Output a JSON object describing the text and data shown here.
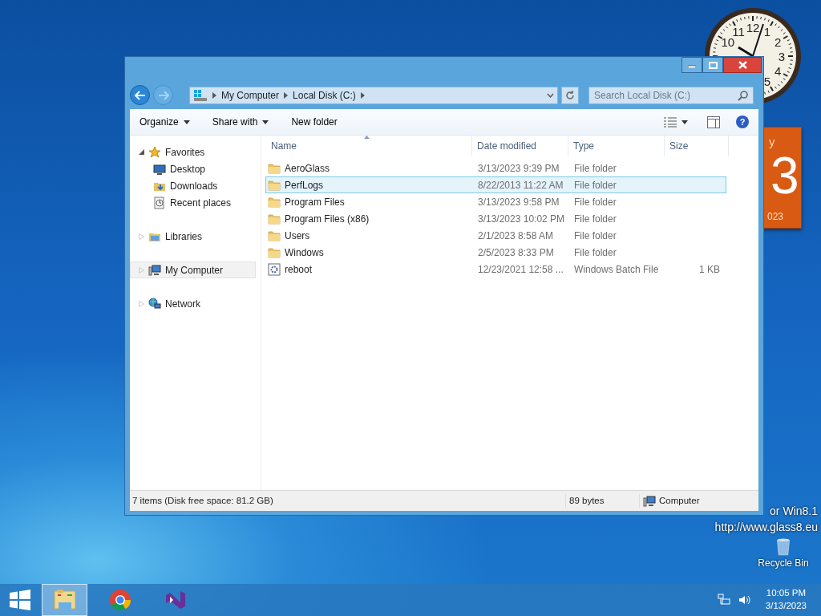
{
  "clock": {
    "numerals": [
      "10",
      "11",
      "12",
      "1",
      "2",
      "3",
      "4",
      "5"
    ]
  },
  "calendar": {
    "weekday": "y",
    "day": "3",
    "year": "023"
  },
  "desktop_text": [
    "or Win8.1",
    "http://www.glass8.eu"
  ],
  "recycle_bin": {
    "label": "Recycle Bin"
  },
  "window": {
    "address": [
      "My Computer",
      "Local Disk (C:)"
    ],
    "search": {
      "placeholder": "Search Local Disk (C:)"
    },
    "toolbar": [
      {
        "label": "Organize",
        "dropdown": true
      },
      {
        "label": "Share with",
        "dropdown": true
      },
      {
        "label": "New folder",
        "dropdown": false
      }
    ],
    "help": "?",
    "sidebar": {
      "items": [
        {
          "label": "Favorites",
          "kind": "star",
          "expanded": true,
          "selected": false,
          "children": [
            {
              "label": "Desktop",
              "kind": "desktop",
              "selected": false
            },
            {
              "label": "Downloads",
              "kind": "downloads",
              "selected": false
            },
            {
              "label": "Recent places",
              "kind": "recent",
              "selected": false
            }
          ]
        },
        {
          "label": "Libraries",
          "kind": "library",
          "expanded": false,
          "selected": false
        },
        {
          "label": "My Computer",
          "kind": "computer",
          "expanded": false,
          "selected": true
        },
        {
          "label": "Network",
          "kind": "network",
          "expanded": false,
          "selected": false
        }
      ]
    },
    "table": {
      "columns": [
        "Name",
        "Date modified",
        "Type",
        "Size"
      ],
      "rows": [
        {
          "name": "AeroGlass",
          "date": "3/13/2023 9:39 PM",
          "type": "File folder",
          "kind": "folder",
          "selected": false
        },
        {
          "name": "PerfLogs",
          "date": "8/22/2013 11:22 AM",
          "type": "File folder",
          "kind": "folder",
          "selected": true
        },
        {
          "name": "Program Files",
          "date": "3/13/2023 9:58 PM",
          "type": "File folder",
          "kind": "folder",
          "selected": false
        },
        {
          "name": "Program Files (x86)",
          "date": "3/13/2023 10:02 PM",
          "type": "File folder",
          "kind": "folder",
          "selected": false
        },
        {
          "name": "Users",
          "date": "2/1/2023 8:58 AM",
          "type": "File folder",
          "kind": "folder",
          "selected": false
        },
        {
          "name": "Windows",
          "date": "2/5/2023 8:33 PM",
          "type": "File folder",
          "kind": "folder",
          "selected": false
        },
        {
          "name": "reboot",
          "date": "12/23/2021 12:58 ...",
          "type": "Windows Batch File",
          "size": "1 KB",
          "kind": "batch",
          "selected": false
        }
      ]
    },
    "status_bar": {
      "items": "7 items (Disk free space: 81.2 GB)",
      "size": "89 bytes",
      "zone": "Computer"
    }
  },
  "taskbar": {
    "apps": [
      {
        "kind": "explorer",
        "selected": true
      },
      {
        "kind": "chrome",
        "selected": false
      },
      {
        "kind": "studio",
        "selected": false
      }
    ],
    "time": "10:05 PM",
    "date": "3/13/2023"
  }
}
